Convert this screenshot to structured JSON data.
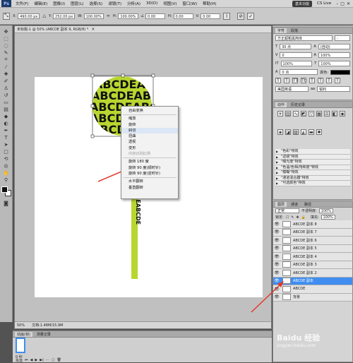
{
  "menubar": {
    "app_icon": "Ps",
    "items": [
      "文件(F)",
      "编辑(E)",
      "图像(I)",
      "图层(L)",
      "选择(S)",
      "滤镜(T)",
      "分析(A)",
      "3D(D)",
      "视图(V)",
      "窗口(W)",
      "帮助(H)"
    ],
    "workspace": "基本功能",
    "cs_live": "CS Live"
  },
  "options": {
    "x_label": "X:",
    "x_value": "490.00 px",
    "y_label": "Y:",
    "y_value": "252.00 px",
    "w_label": "W:",
    "w_value": "100.00%",
    "h_label": "H:",
    "h_value": "100.00%",
    "angle_value": "0.00",
    "h_skew_label": "H:",
    "h_skew_value": "0.00",
    "v_skew_label": "V:",
    "v_skew_value": "0.00",
    "cancel_icon": "cancel-icon",
    "commit_icon": "commit-icon"
  },
  "document": {
    "tab_title": "未标题-1 @ 50% (ABCDE 副本 9, RGB/8) *",
    "zoom": "50%",
    "doc_size": "文档:1.48M/15.9M",
    "canvas_text": "ABCDEABCDEABCDEABCDEABCDE",
    "stem_text": "ABCDEABCDEABCDEABCDE",
    "accent_color": "#b8d630"
  },
  "context_menu": {
    "items": [
      {
        "label": "自由变换",
        "state": "normal"
      },
      {
        "sep": true
      },
      {
        "label": "缩放",
        "state": "normal"
      },
      {
        "label": "旋转",
        "state": "normal"
      },
      {
        "label": "斜切",
        "state": "hover"
      },
      {
        "label": "扭曲",
        "state": "normal"
      },
      {
        "label": "透视",
        "state": "normal"
      },
      {
        "label": "变形",
        "state": "normal"
      },
      {
        "label": "内容识别比例",
        "state": "disabled"
      },
      {
        "sep": true
      },
      {
        "label": "旋转 180 度",
        "state": "normal"
      },
      {
        "label": "旋转 90 度(顺时针)",
        "state": "normal"
      },
      {
        "label": "旋转 90 度(逆时针)",
        "state": "normal"
      },
      {
        "sep": true
      },
      {
        "label": "水平翻转",
        "state": "normal"
      },
      {
        "label": "垂直翻转",
        "state": "normal"
      }
    ]
  },
  "character_panel": {
    "tabs": [
      "字符",
      "段落"
    ],
    "font_family": "方正超粗黑简体",
    "font_style": "-",
    "size": "30 点",
    "leading": "(自动)",
    "tracking": "0",
    "kerning": "100%",
    "vscale": "100%",
    "hscale": "100%",
    "baseline": "0 点",
    "color_label": "颜色:",
    "language": "美国英语",
    "aa": "锐利"
  },
  "actions_panel": {
    "tabs": [
      "动作",
      "历史记录"
    ],
    "items": [
      "\"色彩\"特效",
      "\"滤镜\"特效",
      "\"曝光度\"特效",
      "\"色温/色相/饱和度\"特效",
      "\"模糊\"特效",
      "\"通道混合器\"特效",
      "\"可选颜色\"特效"
    ]
  },
  "layers_panel": {
    "tabs": [
      "图层",
      "通道",
      "路径"
    ],
    "blend_mode": "正常",
    "opacity_label": "不透明度:",
    "opacity": "100%",
    "lock_label": "锁定:",
    "fill_label": "填充:",
    "fill": "100%",
    "layers": [
      {
        "name": "ABCDE 副本 8",
        "selected": false
      },
      {
        "name": "ABCDE 副本 7",
        "selected": false
      },
      {
        "name": "ABCDE 副本 6",
        "selected": false
      },
      {
        "name": "ABCDE 副本 5",
        "selected": false
      },
      {
        "name": "ABCDE 副本 4",
        "selected": false
      },
      {
        "name": "ABCDE 副本 3",
        "selected": false
      },
      {
        "name": "ABCDE 副本 2",
        "selected": false
      },
      {
        "name": "ABCDE 副本",
        "selected": true
      },
      {
        "name": "ABCDE",
        "selected": false
      },
      {
        "name": "背景",
        "selected": false
      }
    ]
  },
  "bottom_panel": {
    "tabs": [
      "动画(帧)",
      "测量记录"
    ],
    "frame_time": "0 秒",
    "loop": "永远"
  },
  "watermark": {
    "main": "Baidu 经验",
    "sub": "jingyan.baidu.com"
  }
}
